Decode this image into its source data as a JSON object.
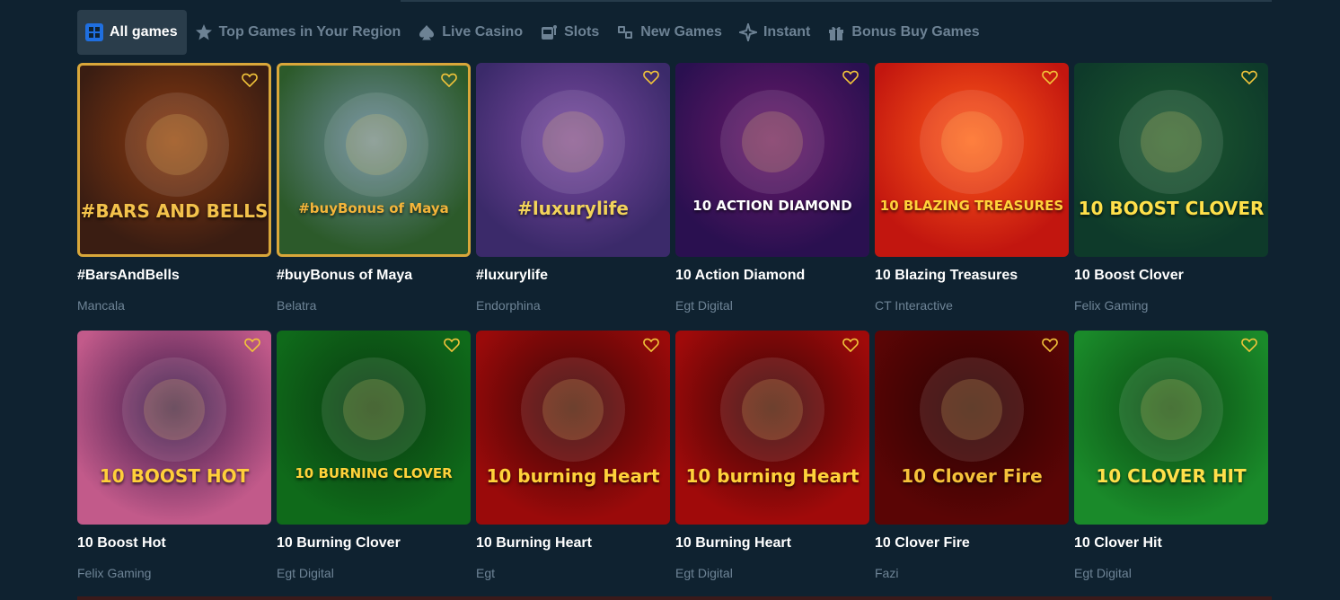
{
  "tabs": [
    {
      "label": "All games",
      "icon": "grid-icon",
      "active": true
    },
    {
      "label": "Top Games in Your Region",
      "icon": "star-icon",
      "active": false
    },
    {
      "label": "Live Casino",
      "icon": "spade-icon",
      "active": false
    },
    {
      "label": "Slots",
      "icon": "slot-machine-icon",
      "active": false
    },
    {
      "label": "New Games",
      "icon": "new-games-icon",
      "active": false
    },
    {
      "label": "Instant",
      "icon": "sparkle-icon",
      "active": false
    },
    {
      "label": "Bonus Buy Games",
      "icon": "gift-icon",
      "active": false
    }
  ],
  "games": [
    {
      "name": "#BarsAndBells",
      "provider": "Mancala",
      "art": "#BARS AND BELLS",
      "colors": [
        "#3a1d12",
        "#8a3a10"
      ],
      "artColor": "#f3c24b"
    },
    {
      "name": "#buyBonus of Maya",
      "provider": "Belatra",
      "art": "#buyBonus of Maya",
      "colors": [
        "#2c5a2a",
        "#6b8a9a"
      ],
      "artColor": "#f4b53a"
    },
    {
      "name": "#luxurylife",
      "provider": "Endorphina",
      "art": "#luxurylife",
      "colors": [
        "#3b2a6a",
        "#7a4aa0"
      ],
      "artColor": "#f2d35a"
    },
    {
      "name": "10 Action Diamond",
      "provider": "Egt Digital",
      "art": "10 ACTION DIAMOND",
      "colors": [
        "#2a1050",
        "#6a1a6a"
      ],
      "artColor": "#ffffff"
    },
    {
      "name": "10 Blazing Treasures",
      "provider": "CT Interactive",
      "art": "10 BLAZING TREASURES",
      "colors": [
        "#c2160f",
        "#ff5a1a"
      ],
      "artColor": "#ffd23a"
    },
    {
      "name": "10 Boost Clover",
      "provider": "Felix Gaming",
      "art": "10 BOOST CLOVER",
      "colors": [
        "#0e3a2a",
        "#1d5a30"
      ],
      "artColor": "#ffe04a"
    },
    {
      "name": "10 Boost Hot",
      "provider": "Felix Gaming",
      "art": "10 BOOST HOT",
      "colors": [
        "#c25a8a",
        "#3a1a4a"
      ],
      "artColor": "#ffcf3a"
    },
    {
      "name": "10 Burning Clover",
      "provider": "Egt Digital",
      "art": "10 BURNING CLOVER",
      "colors": [
        "#0f6a1a",
        "#0a3a10"
      ],
      "artColor": "#ffd23a"
    },
    {
      "name": "10 Burning Heart",
      "provider": "Egt",
      "art": "10 burning Heart",
      "colors": [
        "#9a0a0a",
        "#3a0505"
      ],
      "artColor": "#ffd23a"
    },
    {
      "name": "10 Burning Heart",
      "provider": "Egt Digital",
      "art": "10 burning Heart",
      "colors": [
        "#a00a0a",
        "#3a0505"
      ],
      "artColor": "#ffd23a"
    },
    {
      "name": "10 Clover Fire",
      "provider": "Fazi",
      "art": "10 Clover Fire",
      "colors": [
        "#5a0505",
        "#2a0202"
      ],
      "artColor": "#f6c23a"
    },
    {
      "name": "10 Clover Hit",
      "provider": "Egt Digital",
      "art": "10 CLOVER HIT",
      "colors": [
        "#1a8a2a",
        "#0a4a12"
      ],
      "artColor": "#ffe04a"
    }
  ]
}
